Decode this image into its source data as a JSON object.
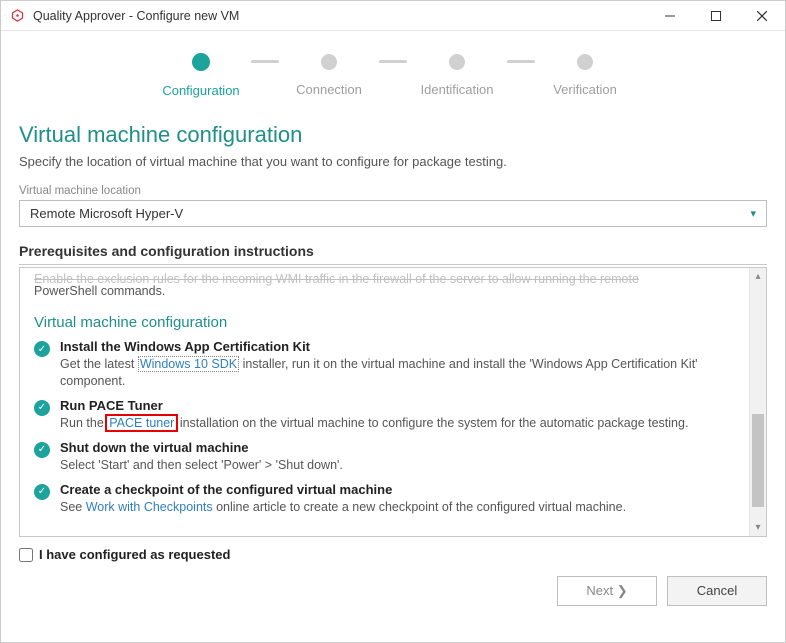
{
  "window": {
    "title": "Quality Approver - Configure new VM"
  },
  "stepper": {
    "steps": [
      {
        "label": "Configuration",
        "active": true
      },
      {
        "label": "Connection",
        "active": false
      },
      {
        "label": "Identification",
        "active": false
      },
      {
        "label": "Verification",
        "active": false
      }
    ]
  },
  "page": {
    "title": "Virtual machine configuration",
    "desc": "Specify the location of virtual machine that you want to configure for package testing."
  },
  "location": {
    "label": "Virtual machine location",
    "value": "Remote Microsoft Hyper-V"
  },
  "prereq": {
    "heading": "Prerequisites and configuration instructions",
    "cut_line": "Enable the exclusion rules for the incoming WMI traffic in the firewall of the server to allow running the remote",
    "cut_para": "PowerShell commands.",
    "sub_heading": "Virtual machine configuration",
    "items": [
      {
        "title": "Install the Windows App Certification Kit",
        "d1": "Get the latest ",
        "link": "Windows 10 SDK",
        "d2": " installer, run it on the virtual machine and install the 'Windows App Certification Kit' component."
      },
      {
        "title": "Run PACE Tuner",
        "d1": "Run the ",
        "link": "PACE tuner",
        "d2": " installation on the virtual machine to configure the system for the automatic package testing."
      },
      {
        "title": "Shut down the virtual machine",
        "d1": "Select 'Start' and then select 'Power' > 'Shut down'.",
        "link": "",
        "d2": ""
      },
      {
        "title": "Create a checkpoint of the configured virtual machine",
        "d1": "See ",
        "link": "Work with Checkpoints",
        "d2": " online article to create a new checkpoint of the configured virtual machine."
      }
    ]
  },
  "confirm": {
    "label": "I have configured as requested"
  },
  "footer": {
    "next": "Next",
    "cancel": "Cancel"
  }
}
